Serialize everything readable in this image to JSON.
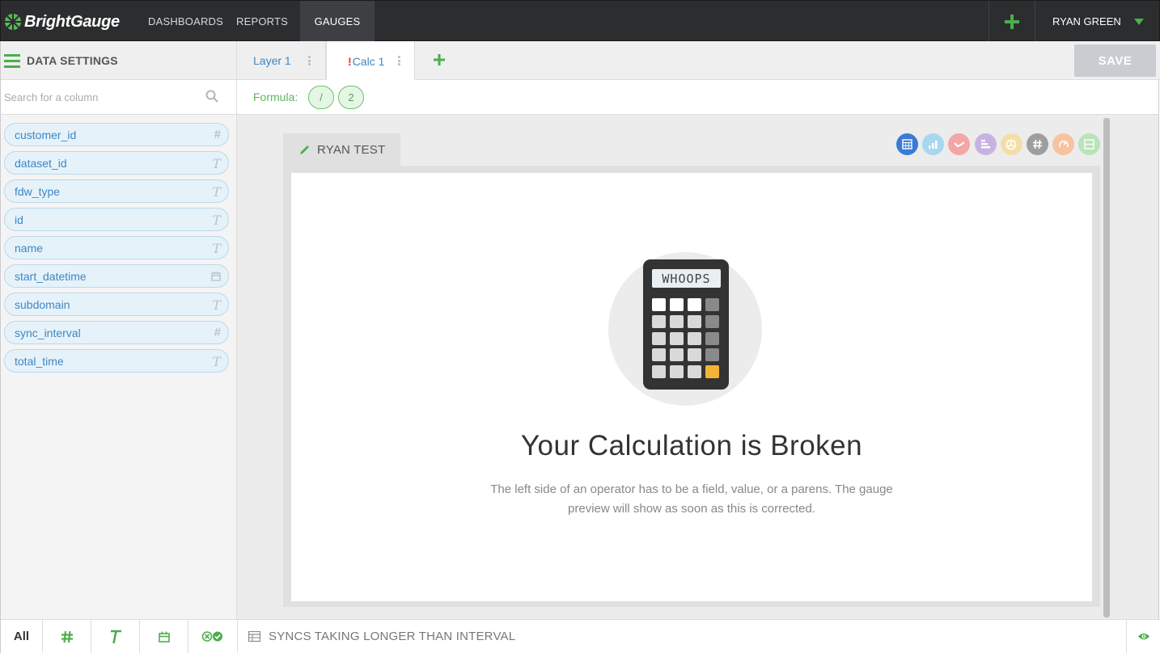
{
  "app": {
    "brand": "BrightGauge"
  },
  "nav": {
    "links": [
      "DASHBOARDS",
      "REPORTS",
      "GAUGES"
    ],
    "active": "GAUGES",
    "user_name": "RYAN GREEN"
  },
  "data_settings": {
    "title": "DATA SETTINGS",
    "search_placeholder": "Search for a column",
    "columns": [
      {
        "name": "customer_id",
        "type": "#"
      },
      {
        "name": "dataset_id",
        "type": "T"
      },
      {
        "name": "fdw_type",
        "type": "T"
      },
      {
        "name": "id",
        "type": "T"
      },
      {
        "name": "name",
        "type": "T"
      },
      {
        "name": "start_datetime",
        "type": "date"
      },
      {
        "name": "subdomain",
        "type": "T"
      },
      {
        "name": "sync_interval",
        "type": "#"
      },
      {
        "name": "total_time",
        "type": "T"
      }
    ]
  },
  "tabs": {
    "layer": "Layer 1",
    "calc_warning": "!",
    "calc": "Calc 1",
    "save_label": "SAVE"
  },
  "formula": {
    "label": "Formula:",
    "tokens": [
      "/",
      "2"
    ]
  },
  "gauge": {
    "title": "RYAN TEST",
    "types": [
      {
        "icon": "calculator-icon",
        "color": "#3a7bd5"
      },
      {
        "icon": "bar-chart-icon",
        "color": "#a8d8ef"
      },
      {
        "icon": "line-chart-icon",
        "color": "#f3a6a6"
      },
      {
        "icon": "horizontal-bar-icon",
        "color": "#c8b3e0"
      },
      {
        "icon": "pie-chart-icon",
        "color": "#f3dfa6"
      },
      {
        "icon": "number-icon",
        "color": "#9e9e9e"
      },
      {
        "icon": "dial-icon",
        "color": "#f5c3a0"
      },
      {
        "icon": "table-icon",
        "color": "#b9e3b9"
      }
    ],
    "calculator_display": "WHOOPS",
    "error_title": "Your Calculation is Broken",
    "error_desc": "The left side of an operator has to be a field, value, or a parens. The gauge preview will show as soon as this is corrected."
  },
  "bottom": {
    "filter_all": "All",
    "status_text": "SYNCS TAKING LONGER THAN INTERVAL"
  },
  "colors": {
    "accent_green": "#4cae4c",
    "link_blue": "#3d87c4",
    "nav_bg": "#2b2d2f"
  }
}
